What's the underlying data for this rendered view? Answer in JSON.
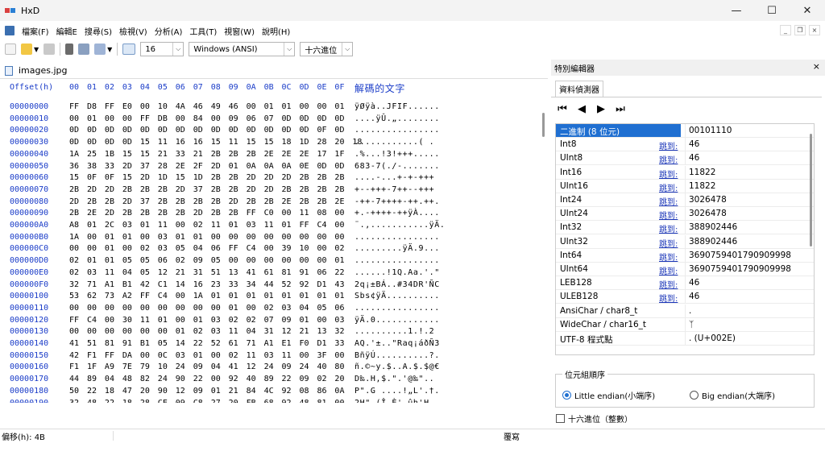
{
  "window": {
    "title": "HxD",
    "controls": [
      "—",
      "☐",
      "✕"
    ]
  },
  "menu": {
    "items": [
      "檔案(F)",
      "編輯E",
      "搜尋(S)",
      "檢視(V)",
      "分析(A)",
      "工具(T)",
      "視窗(W)",
      "說明(H)"
    ],
    "right_controls": [
      "_",
      "❐",
      "×"
    ]
  },
  "toolbar": {
    "bytes_per_row": "16",
    "charset": "Windows (ANSI)",
    "offset_base": "十六進位"
  },
  "document": {
    "tab_name": "images.jpg"
  },
  "hex": {
    "header": {
      "offset_label": "Offset(h)",
      "columns": "00 01 02 03 04 05 06 07 08 09 0A 0B 0C 0D 0E 0F",
      "text_label": "解碼的文字"
    },
    "rows": [
      {
        "off": "00000000",
        "hex": "FF D8 FF E0 00 10 4A 46 49 46 00 01 01 00 00 01",
        "txt": "ÿØÿà..JFIF......"
      },
      {
        "off": "00000010",
        "hex": "00 01 00 00 FF DB 00 84 00 09 06 07 0D 0D 0D 0D",
        "txt": "....ÿÛ.„........"
      },
      {
        "off": "00000020",
        "hex": "0D 0D 0D 0D 0D 0D 0D 0D 0D 0D 0D 0D 0D 0D 0F 0D",
        "txt": "................"
      },
      {
        "off": "00000030",
        "hex": "0D 0D 0D 0D 15 11 16 16 15 11 15 15 18 1D 28 20 18",
        "txt": "............( ."
      },
      {
        "off": "00000040",
        "hex": "1A 25 1B 15 15 21 33 21 2B 2B 2B 2E 2E 2E 17 1F",
        "txt": ".%...!3!+++....."
      },
      {
        "off": "00000050",
        "hex": "36 38 33 2D 37 28 2E 2F 2D 01 0A 0A 0A 0E 0D 0D",
        "txt": "683-7(./-......."
      },
      {
        "off": "00000060",
        "hex": "15 0F 0F 15 2D 1D 15 1D 2B 2B 2D 2D 2D 2B 2B 2B",
        "txt": "....-...+-+-+++"
      },
      {
        "off": "00000070",
        "hex": "2B 2D 2D 2B 2B 2B 2D 37 2B 2B 2D 2D 2B 2B 2B 2B",
        "txt": "+--+++-7++--+++"
      },
      {
        "off": "00000080",
        "hex": "2D 2B 2B 2D 37 2B 2B 2B 2B 2D 2B 2B 2E 2B 2B 2E",
        "txt": "-++-7++++-++.++."
      },
      {
        "off": "00000090",
        "hex": "2B 2E 2D 2B 2B 2B 2B 2D 2B 2B FF C0 00 11 08 00",
        "txt": "+.-++++-++ÿÀ...."
      },
      {
        "off": "000000A0",
        "hex": "A8 01 2C 03 01 11 00 02 11 01 03 11 01 FF C4 00",
        "txt": "¨.,...........ÿÄ."
      },
      {
        "off": "000000B0",
        "hex": "1A 00 01 01 00 03 01 01 00 00 00 00 00 00 00 00",
        "txt": "................"
      },
      {
        "off": "000000C0",
        "hex": "00 00 01 00 02 03 05 04 06 FF C4 00 39 10 00 02",
        "txt": ".........ÿÄ.9..."
      },
      {
        "off": "000000D0",
        "hex": "02 01 01 05 05 06 02 09 05 00 00 00 00 00 00 01",
        "txt": "................"
      },
      {
        "off": "000000E0",
        "hex": "02 03 11 04 05 12 21 31 51 13 41 61 81 91 06 22",
        "txt": "......!1Q.Aa.'.\""
      },
      {
        "off": "000000F0",
        "hex": "32 71 A1 B1 42 C1 14 16 23 33 34 44 52 92 D1 43",
        "txt": "2q¡±BÁ..#34DR'ÑC"
      },
      {
        "off": "00000100",
        "hex": "53 62 73 A2 FF C4 00 1A 01 01 01 01 01 01 01 01",
        "txt": "Sbs¢ÿÄ.........."
      },
      {
        "off": "00000110",
        "hex": "00 00 00 00 00 00 00 00 00 01 00 02 03 04 05 06",
        "txt": "................"
      },
      {
        "off": "00000120",
        "hex": "FF C4 00 30 11 01 00 01 03 02 02 07 09 01 00 03",
        "txt": "ÿÄ.0............"
      },
      {
        "off": "00000130",
        "hex": "00 00 00 00 00 00 01 02 03 11 04 31 12 21 13 32",
        "txt": "..........1.!.2"
      },
      {
        "off": "00000140",
        "hex": "41 51 81 91 B1 05 14 22 52 61 71 A1 E1 F0 D1 33",
        "txt": "AQ.'±..\"Raq¡áðÑ3"
      },
      {
        "off": "00000150",
        "hex": "42 F1 FF DA 00 0C 03 01 00 02 11 03 11 00 3F 00",
        "txt": "BñÿÚ..........?."
      },
      {
        "off": "00000160",
        "hex": "F1 1F A9 7E 79 10 24 09 04 41 12 24 09 24 40 80",
        "txt": "ñ.©~y.$..A.$.$@€"
      },
      {
        "off": "00000170",
        "hex": "44 89 04 48 82 24 90 22 00 92 40 89 22 09 02 20",
        "txt": "D‰.H‚$.\".'@‰\".. "
      },
      {
        "off": "00000180",
        "hex": "50 22 18 47 20 90 12 09 01 21 84 4C 92 08 86 0A",
        "txt": "P\".G ....!„L'.†."
      },
      {
        "off": "00000190",
        "hex": "32 48 22 18 28 CE 09 C8 27 20 FB 68 92 48 81 00",
        "txt": "2H\".(Î.È' ûh'H.."
      }
    ]
  },
  "status": {
    "offset": "偏移(h): 4B",
    "mode": "覆寫"
  },
  "panel": {
    "title": "特別編輯器",
    "tab": "資料偵測器",
    "nav": [
      "⏮",
      "◀",
      "▶",
      "⏭"
    ],
    "jump_label": "跳到:",
    "rows": [
      {
        "label": "二進制 (8 位元)",
        "value": "00101110",
        "jump": false,
        "selected": true
      },
      {
        "label": "Int8",
        "value": "46",
        "jump": true
      },
      {
        "label": "UInt8",
        "value": "46",
        "jump": true
      },
      {
        "label": "Int16",
        "value": "11822",
        "jump": true
      },
      {
        "label": "UInt16",
        "value": "11822",
        "jump": true
      },
      {
        "label": "Int24",
        "value": "3026478",
        "jump": true
      },
      {
        "label": "UInt24",
        "value": "3026478",
        "jump": true
      },
      {
        "label": "Int32",
        "value": "388902446",
        "jump": true
      },
      {
        "label": "UInt32",
        "value": "388902446",
        "jump": true
      },
      {
        "label": "Int64",
        "value": "3690759401790909998",
        "jump": true
      },
      {
        "label": "UInt64",
        "value": "3690759401790909998",
        "jump": true
      },
      {
        "label": "LEB128",
        "value": "46",
        "jump": true
      },
      {
        "label": "ULEB128",
        "value": "46",
        "jump": true
      },
      {
        "label": "AnsiChar / char8_t",
        "value": ".",
        "jump": false
      },
      {
        "label": "WideChar / char16_t",
        "value": "ᛉ",
        "jump": false
      },
      {
        "label": "UTF-8 程式點",
        "value": ". (U+002E)",
        "jump": false
      }
    ],
    "byte_order_title": "位元組順序",
    "little_endian": "Little endian(小端序)",
    "big_endian": "Big endian(大端序)",
    "hex_check": "十六進位（整數）"
  },
  "colors": {
    "accent": "#1f6fd1",
    "offset_blue": "#1a3cc8"
  }
}
